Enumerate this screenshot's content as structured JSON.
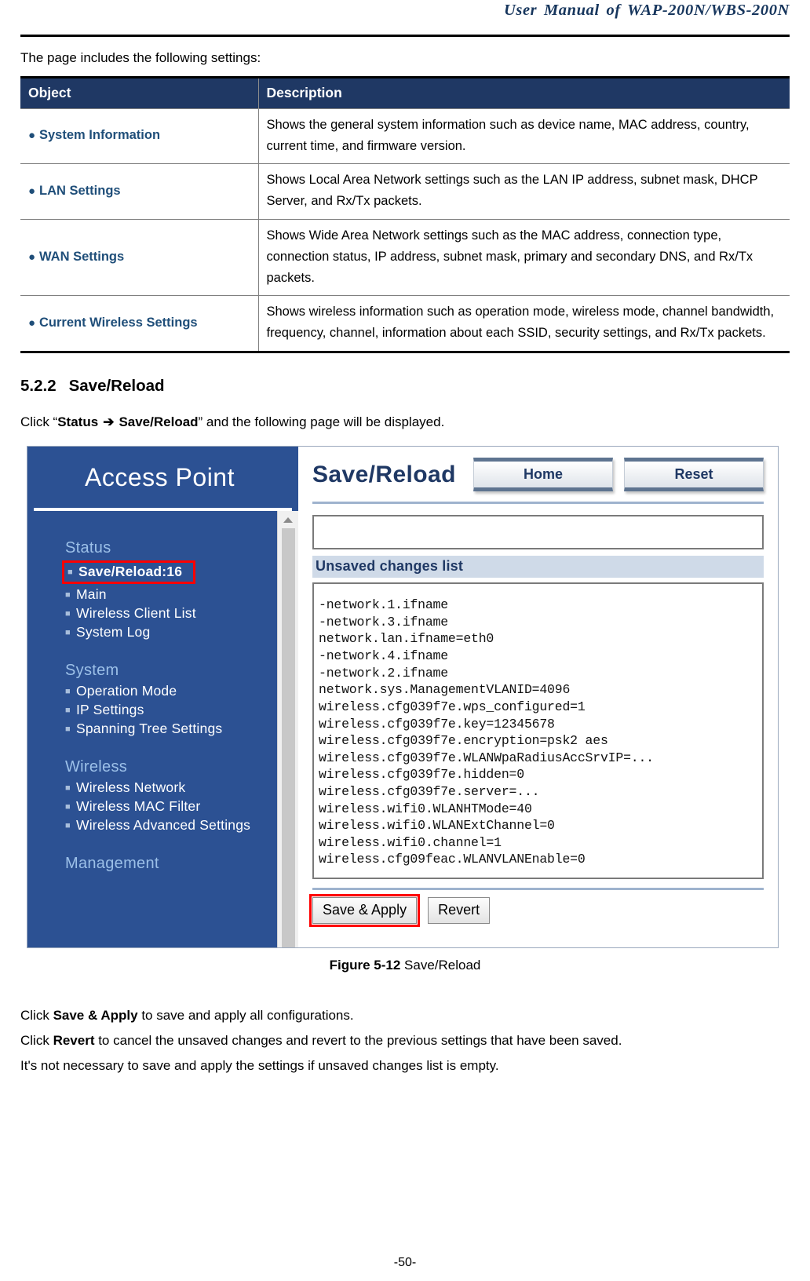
{
  "header": {
    "running_title": "User Manual of WAP-200N/WBS-200N"
  },
  "intro": {
    "line": "The page includes the following settings:"
  },
  "settings_table": {
    "columns": [
      "Object",
      "Description"
    ],
    "rows": [
      {
        "object": "System Information",
        "description": "Shows the general system information such as device name, MAC address, country, current time, and firmware version."
      },
      {
        "object": "LAN Settings",
        "description": "Shows Local Area Network settings such as the LAN IP address, subnet mask, DHCP Server, and Rx/Tx packets."
      },
      {
        "object": "WAN Settings",
        "description": "Shows Wide Area Network settings such as the MAC address, connection type, connection status, IP address, subnet mask, primary and secondary DNS, and Rx/Tx packets."
      },
      {
        "object": "Current Wireless Settings",
        "description": "Shows wireless information such as operation mode, wireless mode, channel bandwidth, frequency, channel, information about each SSID, security settings, and Rx/Tx packets."
      }
    ]
  },
  "section": {
    "number": "5.2.2",
    "title": "Save/Reload",
    "click_prefix": "Click “",
    "click_path_a": "Status",
    "click_arrow": "➔",
    "click_path_b": "Save/Reload",
    "click_suffix": "” and the following page will be displayed."
  },
  "screenshot": {
    "brand": "Access Point",
    "nav": [
      {
        "type": "group",
        "label": "Status"
      },
      {
        "type": "item",
        "label": "Save/Reload:16",
        "current": true
      },
      {
        "type": "item",
        "label": "Main",
        "current": false
      },
      {
        "type": "item",
        "label": "Wireless Client List",
        "current": false
      },
      {
        "type": "item",
        "label": "System Log",
        "current": false
      },
      {
        "type": "group",
        "label": "System"
      },
      {
        "type": "item",
        "label": "Operation Mode",
        "current": false
      },
      {
        "type": "item",
        "label": "IP Settings",
        "current": false
      },
      {
        "type": "item",
        "label": "Spanning Tree Settings",
        "current": false
      },
      {
        "type": "group",
        "label": "Wireless"
      },
      {
        "type": "item",
        "label": "Wireless Network",
        "current": false
      },
      {
        "type": "item",
        "label": "Wireless MAC Filter",
        "current": false
      },
      {
        "type": "item",
        "label": "Wireless Advanced Settings",
        "current": false
      },
      {
        "type": "group",
        "label": "Management"
      }
    ],
    "page_title": "Save/Reload",
    "buttons": {
      "home": "Home",
      "reset": "Reset"
    },
    "top_input_value": "",
    "changes_label": "Unsaved changes list",
    "changes_list": [
      "-network.1.ifname",
      "-network.3.ifname",
      "network.lan.ifname=eth0",
      "-network.4.ifname",
      "-network.2.ifname",
      "network.sys.ManagementVLANID=4096",
      "wireless.cfg039f7e.wps_configured=1",
      "wireless.cfg039f7e.key=12345678",
      "wireless.cfg039f7e.encryption=psk2 aes",
      "wireless.cfg039f7e.WLANWpaRadiusAccSrvIP=...",
      "wireless.cfg039f7e.hidden=0",
      "wireless.cfg039f7e.server=...",
      "wireless.wifi0.WLANHTMode=40",
      "wireless.wifi0.WLANExtChannel=0",
      "wireless.wifi0.channel=1",
      "wireless.cfg09feac.WLANVLANEnable=0"
    ],
    "save_apply": "Save & Apply",
    "revert": "Revert",
    "highlight_color": "#FF0000"
  },
  "figure": {
    "label": "Figure 5-12",
    "caption": "Save/Reload"
  },
  "after_figure": {
    "line1_prefix": "Click ",
    "line1_bold": "Save & Apply",
    "line1_suffix": " to save and apply all configurations.",
    "line2_prefix": "Click ",
    "line2_bold": "Revert",
    "line2_suffix": " to cancel the unsaved changes and revert to the previous settings that have been saved.",
    "line3": "It's not necessary to save and apply the settings if unsaved changes list is empty."
  },
  "footer": {
    "page_number": "-50-"
  }
}
